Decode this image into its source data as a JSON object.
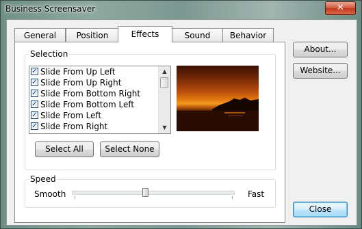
{
  "window": {
    "title": "Business Screensaver",
    "close_glyph": "✕"
  },
  "tabs": [
    {
      "label": "General"
    },
    {
      "label": "Position"
    },
    {
      "label": "Effects",
      "active": true
    },
    {
      "label": "Sound"
    },
    {
      "label": "Behavior"
    }
  ],
  "selection": {
    "label": "Selection",
    "items": [
      {
        "label": "Slide From Up Left",
        "checked": true
      },
      {
        "label": "Slide From Up Right",
        "checked": true
      },
      {
        "label": "Slide From Bottom Right",
        "checked": true
      },
      {
        "label": "Slide From Bottom Left",
        "checked": true
      },
      {
        "label": "Slide From Left",
        "checked": true
      },
      {
        "label": "Slide From Right",
        "checked": true
      }
    ],
    "select_all": "Select All",
    "select_none": "Select None"
  },
  "preview_icon": "sunset-preview-image",
  "speed": {
    "label": "Speed",
    "min_label": "Smooth",
    "max_label": "Fast",
    "level": 0.45
  },
  "side_buttons": {
    "about": "About...",
    "website": "Website...",
    "close": "Close"
  },
  "colors": {
    "accent_button": "#a7d9f5",
    "close_titlebar": "#c2391b"
  }
}
